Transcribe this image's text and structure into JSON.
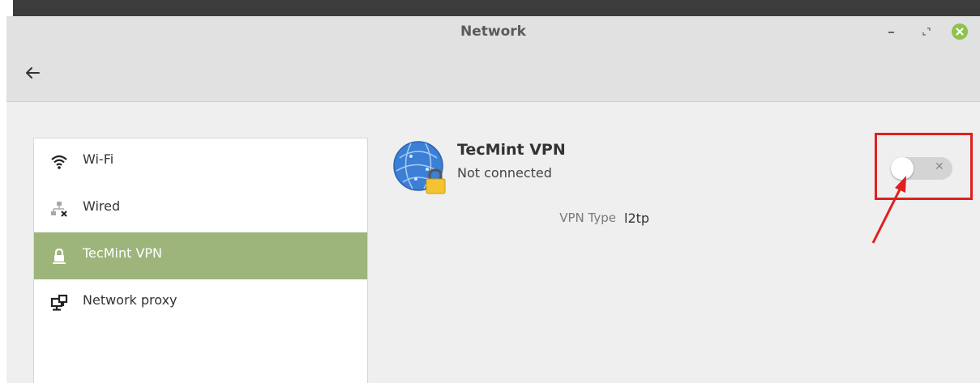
{
  "window": {
    "title": "Network"
  },
  "sidebar": {
    "items": [
      {
        "label": "Wi-Fi",
        "icon": "wifi-icon",
        "active": false
      },
      {
        "label": "Wired",
        "icon": "wired-network-icon",
        "active": false
      },
      {
        "label": "TecMint VPN",
        "icon": "vpn-lock-icon",
        "active": true
      },
      {
        "label": "Network proxy",
        "icon": "network-proxy-icon",
        "active": false
      }
    ]
  },
  "vpn": {
    "name": "TecMint VPN",
    "status": "Not connected",
    "type_label": "VPN Type",
    "type_value": "l2tp",
    "toggle_on": false
  },
  "colors": {
    "active_item": "#9db57a",
    "close_button": "#8cc34e",
    "annotation": "#e02020"
  }
}
